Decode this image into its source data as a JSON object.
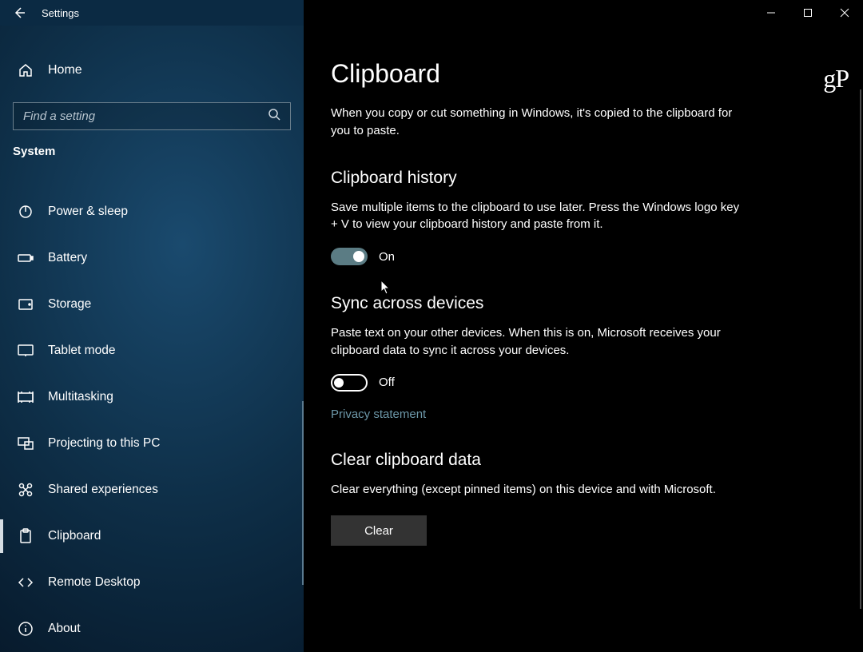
{
  "titlebar": {
    "title": "Settings"
  },
  "sidebar": {
    "home_label": "Home",
    "search_placeholder": "Find a setting",
    "category": "System",
    "items": [
      {
        "id": "power-sleep",
        "label": "Power & sleep",
        "icon": "power-icon"
      },
      {
        "id": "battery",
        "label": "Battery",
        "icon": "battery-icon"
      },
      {
        "id": "storage",
        "label": "Storage",
        "icon": "storage-icon"
      },
      {
        "id": "tablet-mode",
        "label": "Tablet mode",
        "icon": "tablet-icon"
      },
      {
        "id": "multitasking",
        "label": "Multitasking",
        "icon": "multitasking-icon"
      },
      {
        "id": "projecting",
        "label": "Projecting to this PC",
        "icon": "projecting-icon"
      },
      {
        "id": "shared-experiences",
        "label": "Shared experiences",
        "icon": "shared-icon"
      },
      {
        "id": "clipboard",
        "label": "Clipboard",
        "icon": "clipboard-icon",
        "active": true
      },
      {
        "id": "remote-desktop",
        "label": "Remote Desktop",
        "icon": "remote-icon"
      },
      {
        "id": "about",
        "label": "About",
        "icon": "about-icon"
      }
    ]
  },
  "main": {
    "title": "Clipboard",
    "intro": "When you copy or cut something in Windows, it's copied to the clipboard for you to paste.",
    "watermark": "gP",
    "history": {
      "title": "Clipboard history",
      "desc": "Save multiple items to the clipboard to use later. Press the Windows logo key + V to view your clipboard history and paste from it.",
      "toggle_state": "on",
      "toggle_label": "On"
    },
    "sync": {
      "title": "Sync across devices",
      "desc": "Paste text on your other devices. When this is on, Microsoft receives your clipboard data to sync it across your devices.",
      "toggle_state": "off",
      "toggle_label": "Off",
      "privacy_link": "Privacy statement"
    },
    "clear": {
      "title": "Clear clipboard data",
      "desc": "Clear everything (except pinned items) on this device and with Microsoft.",
      "button_label": "Clear"
    }
  }
}
